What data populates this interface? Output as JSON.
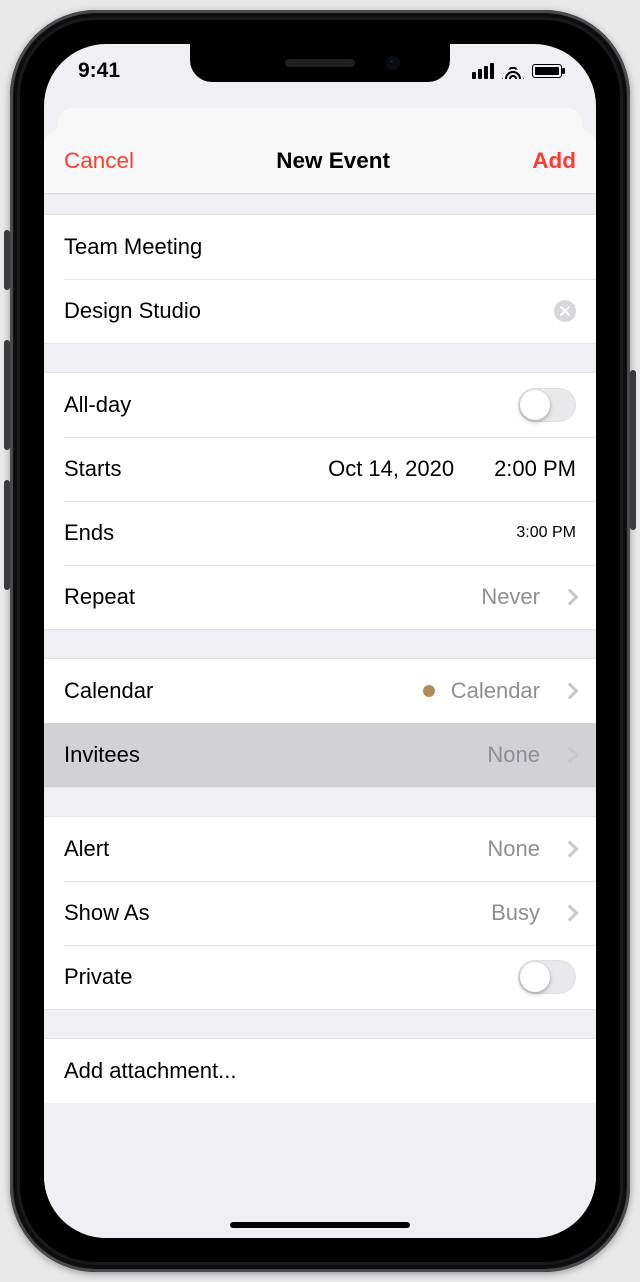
{
  "statusbar": {
    "time": "9:41"
  },
  "nav": {
    "cancel": "Cancel",
    "title": "New Event",
    "add": "Add"
  },
  "basic": {
    "title": "Team Meeting",
    "location": "Design Studio"
  },
  "timing": {
    "allday_label": "All-day",
    "starts_label": "Starts",
    "starts_date": "Oct 14, 2020",
    "starts_time": "2:00 PM",
    "ends_label": "Ends",
    "ends_time": "3:00 PM",
    "repeat_label": "Repeat",
    "repeat_value": "Never"
  },
  "calendar": {
    "label": "Calendar",
    "value": "Calendar",
    "dot_color": "#b38b58",
    "invitees_label": "Invitees",
    "invitees_value": "None"
  },
  "options": {
    "alert_label": "Alert",
    "alert_value": "None",
    "showas_label": "Show As",
    "showas_value": "Busy",
    "private_label": "Private"
  },
  "attachment": {
    "label": "Add attachment..."
  }
}
